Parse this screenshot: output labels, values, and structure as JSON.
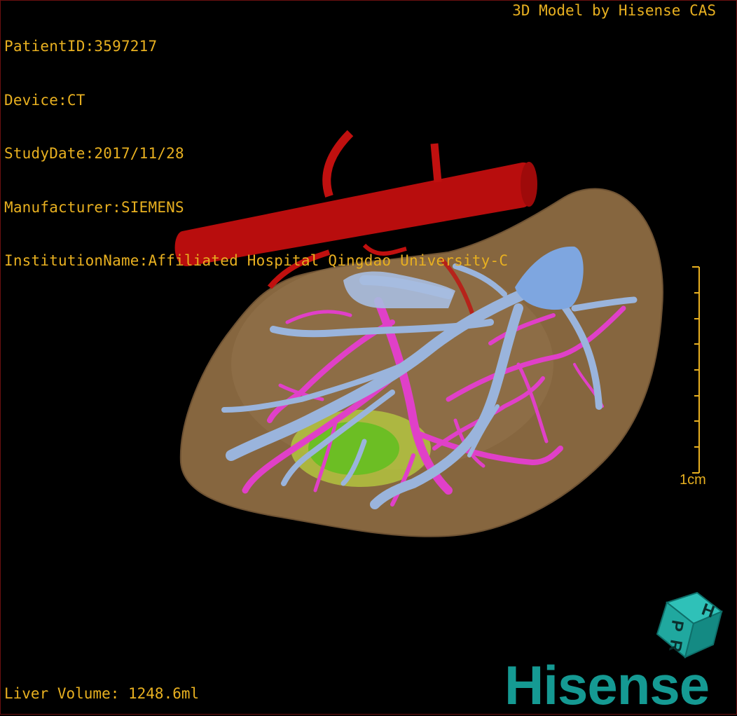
{
  "header": {
    "patient_id": "PatientID:3597217",
    "device": "Device:CT",
    "study_date": "StudyDate:2017/11/28",
    "manufacturer": "Manufacturer:SIEMENS",
    "institution": "InstitutionName:Affiliated Hospital Qingdao University-C"
  },
  "credit": "3D Model by Hisense CAS",
  "footer": {
    "liver_volume": "Liver Volume: 1248.6ml"
  },
  "scale": {
    "label": "1cm"
  },
  "brand": {
    "name": "Hisense",
    "cube_letters": [
      "H",
      "P",
      "R"
    ]
  },
  "colors": {
    "overlay_text": "#e8b020",
    "liver": "#8a6a45",
    "artery_red": "#c0100f",
    "portal_vein": "#9ab4dc",
    "hepatic_vein": "#e040c8",
    "lesion": "#9acd32",
    "brand_teal": "#159a93"
  }
}
